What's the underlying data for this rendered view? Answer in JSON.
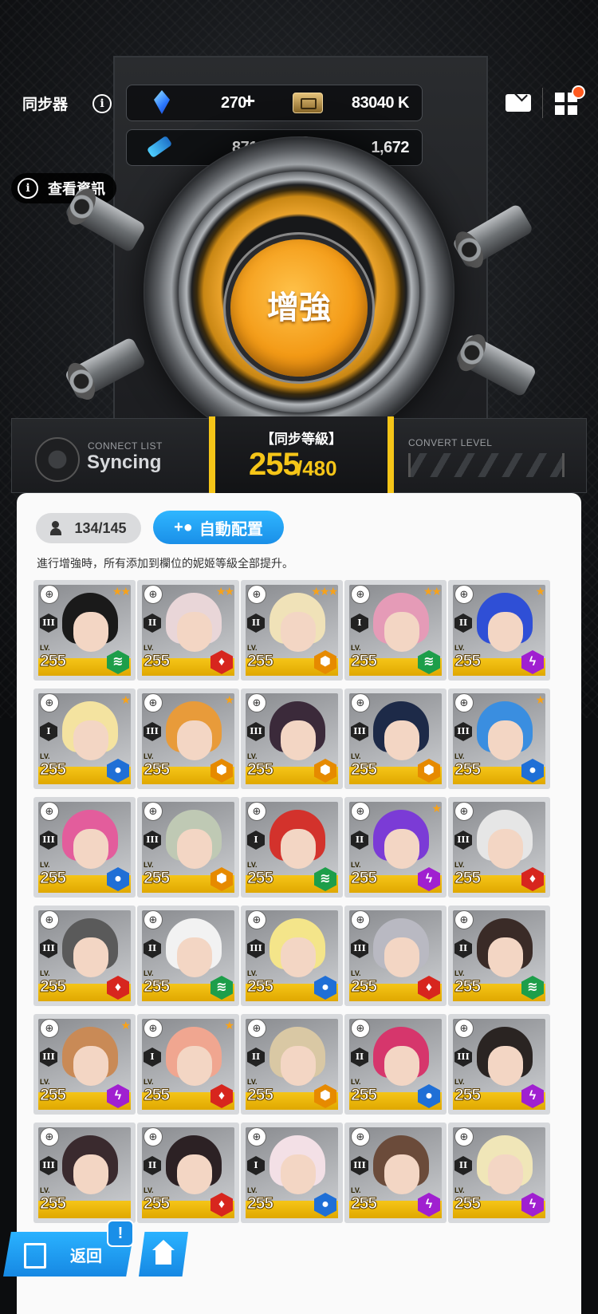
{
  "header": {
    "title": "同步器",
    "view_info": "查看資訊",
    "gems": "270",
    "credits": "83040 K",
    "battle_data": "871 M",
    "core_dust": "1,672"
  },
  "reactor": {
    "button_label": "增強"
  },
  "status": {
    "connect_label": "CONNECT LIST",
    "syncing": "Syncing",
    "level_title": "【同步等級】",
    "level_current": "255",
    "level_max": "/480",
    "convert_label": "CONVERT LEVEL"
  },
  "panel": {
    "slot_count": "134/145",
    "auto_button": "自動配置",
    "description": "進行增強時，所有添加到欄位的妮姬等級全部提升。"
  },
  "grid": {
    "level_prefix": "LV.",
    "cards": [
      {
        "level": "255",
        "burst": "III",
        "stars": "★★",
        "element": "wind",
        "color": "#1d9e4a"
      },
      {
        "level": "255",
        "burst": "II",
        "stars": "★★",
        "element": "fire",
        "color": "#d7261e"
      },
      {
        "level": "255",
        "burst": "II",
        "stars": "★★★",
        "element": "iron",
        "color": "#e68a00"
      },
      {
        "level": "255",
        "burst": "I",
        "stars": "★★",
        "element": "wind",
        "color": "#1d9e4a"
      },
      {
        "level": "255",
        "burst": "II",
        "stars": "★",
        "element": "electric",
        "color": "#a020d0"
      },
      {
        "level": "255",
        "burst": "I",
        "stars": "★",
        "element": "water",
        "color": "#1f6fd6"
      },
      {
        "level": "255",
        "burst": "III",
        "stars": "★",
        "element": "iron",
        "color": "#e68a00"
      },
      {
        "level": "255",
        "burst": "III",
        "stars": "",
        "element": "iron",
        "color": "#e68a00"
      },
      {
        "level": "255",
        "burst": "III",
        "stars": "",
        "element": "iron",
        "color": "#e68a00"
      },
      {
        "level": "255",
        "burst": "III",
        "stars": "★",
        "element": "water",
        "color": "#1f6fd6"
      },
      {
        "level": "255",
        "burst": "III",
        "stars": "",
        "element": "water",
        "color": "#1f6fd6"
      },
      {
        "level": "255",
        "burst": "III",
        "stars": "",
        "element": "iron",
        "color": "#e68a00"
      },
      {
        "level": "255",
        "burst": "I",
        "stars": "",
        "element": "wind",
        "color": "#1d9e4a"
      },
      {
        "level": "255",
        "burst": "II",
        "stars": "★",
        "element": "electric",
        "color": "#a020d0"
      },
      {
        "level": "255",
        "burst": "III",
        "stars": "",
        "element": "fire",
        "color": "#d7261e"
      },
      {
        "level": "255",
        "burst": "III",
        "stars": "",
        "element": "fire",
        "color": "#d7261e"
      },
      {
        "level": "255",
        "burst": "II",
        "stars": "",
        "element": "wind",
        "color": "#1d9e4a"
      },
      {
        "level": "255",
        "burst": "III",
        "stars": "",
        "element": "water",
        "color": "#1f6fd6"
      },
      {
        "level": "255",
        "burst": "III",
        "stars": "",
        "element": "fire",
        "color": "#d7261e"
      },
      {
        "level": "255",
        "burst": "II",
        "stars": "",
        "element": "wind",
        "color": "#1d9e4a"
      },
      {
        "level": "255",
        "burst": "III",
        "stars": "★",
        "element": "electric",
        "color": "#a020d0"
      },
      {
        "level": "255",
        "burst": "I",
        "stars": "★",
        "element": "fire",
        "color": "#d7261e"
      },
      {
        "level": "255",
        "burst": "II",
        "stars": "",
        "element": "iron",
        "color": "#e68a00"
      },
      {
        "level": "255",
        "burst": "II",
        "stars": "",
        "element": "water",
        "color": "#1f6fd6"
      },
      {
        "level": "255",
        "burst": "III",
        "stars": "",
        "element": "electric",
        "color": "#a020d0"
      },
      {
        "level": "255",
        "burst": "III",
        "stars": "",
        "element": "",
        "color": "#a020d0"
      },
      {
        "level": "255",
        "burst": "II",
        "stars": "",
        "element": "fire",
        "color": "#d7261e"
      },
      {
        "level": "255",
        "burst": "I",
        "stars": "",
        "element": "water",
        "color": "#1f6fd6"
      },
      {
        "level": "255",
        "burst": "III",
        "stars": "",
        "element": "electric",
        "color": "#a020d0"
      },
      {
        "level": "255",
        "burst": "II",
        "stars": "",
        "element": "electric",
        "color": "#a020d0"
      }
    ]
  },
  "nav": {
    "back_label": "返回",
    "alert": "!"
  }
}
